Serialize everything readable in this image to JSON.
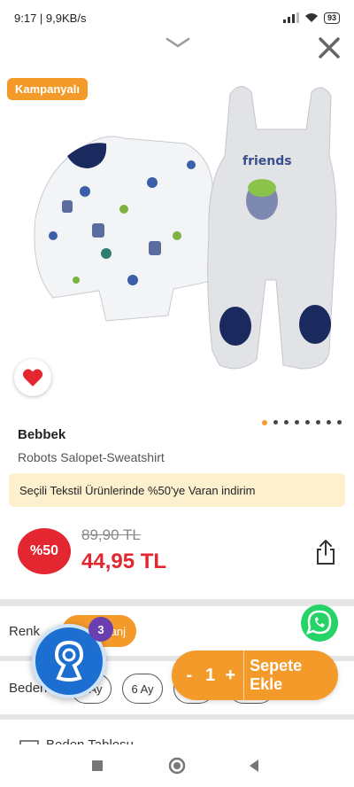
{
  "status_bar": {
    "time": "9:17",
    "speed": "9,9KB/s",
    "battery": "93"
  },
  "icons": {
    "collapse": "chevron-down-icon",
    "close": "close-icon",
    "favorite": "heart-icon",
    "share": "share-icon",
    "whatsapp": "whatsapp-icon",
    "assistant": "assistant-icon"
  },
  "badge": {
    "campaign": "Kampanyalı"
  },
  "gallery": {
    "image_count": 8,
    "active_index": 0
  },
  "product": {
    "brand": "Bebbek",
    "name": "Robots Salopet-Sweatshirt",
    "promo": "Seçili Tekstil Ürünlerinde %50'ye Varan indirim"
  },
  "pricing": {
    "discount": "%50",
    "old_price": "89,90 TL",
    "new_price": "44,95 TL"
  },
  "options": {
    "color_label": "Renk",
    "color_value": "anj",
    "size_label": "Beden",
    "sizes": [
      "3 Ay",
      "6 Ay",
      "",
      ""
    ]
  },
  "assistant": {
    "count": "3"
  },
  "cart": {
    "minus": "-",
    "quantity": "1",
    "plus": "+",
    "add_label": "Sepete Ekle"
  },
  "size_table": {
    "label": "Beden Tablosu"
  },
  "colors": {
    "accent": "#f39a2b",
    "sale": "#e3262f",
    "promo_bg": "#fdf0cf"
  }
}
